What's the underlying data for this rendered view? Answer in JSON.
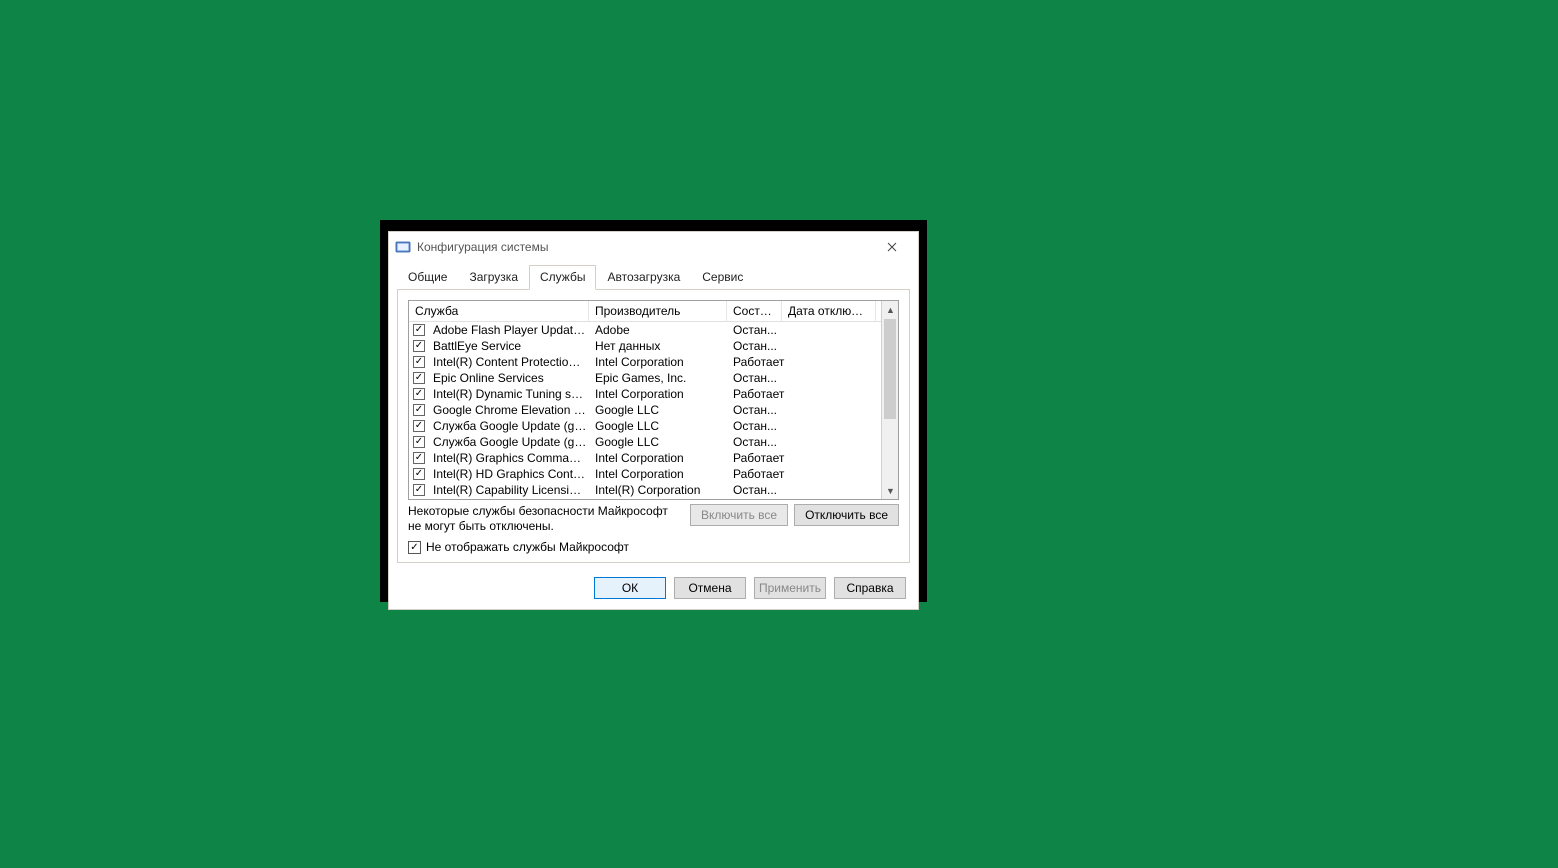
{
  "window": {
    "title": "Конфигурация системы"
  },
  "tabs": {
    "general": "Общие",
    "boot": "Загрузка",
    "services": "Службы",
    "startup": "Автозагрузка",
    "tools": "Сервис",
    "active": "services"
  },
  "columns": {
    "service": "Служба",
    "manufacturer": "Производитель",
    "status": "Состоя...",
    "date": "Дата отключе..."
  },
  "rows": [
    {
      "checked": true,
      "service": "Adobe Flash Player Update Service",
      "manufacturer": "Adobe",
      "status": "Остан...",
      "date": ""
    },
    {
      "checked": true,
      "service": "BattlEye Service",
      "manufacturer": "Нет данных",
      "status": "Остан...",
      "date": ""
    },
    {
      "checked": true,
      "service": "Intel(R) Content Protection HDC...",
      "manufacturer": "Intel Corporation",
      "status": "Работает",
      "date": ""
    },
    {
      "checked": true,
      "service": "Epic Online Services",
      "manufacturer": "Epic Games, Inc.",
      "status": "Остан...",
      "date": ""
    },
    {
      "checked": true,
      "service": "Intel(R) Dynamic Tuning service",
      "manufacturer": "Intel Corporation",
      "status": "Работает",
      "date": ""
    },
    {
      "checked": true,
      "service": "Google Chrome Elevation Servic...",
      "manufacturer": "Google LLC",
      "status": "Остан...",
      "date": ""
    },
    {
      "checked": true,
      "service": "Служба Google Update (gupdate)",
      "manufacturer": "Google LLC",
      "status": "Остан...",
      "date": ""
    },
    {
      "checked": true,
      "service": "Служба Google Update (gupdat...",
      "manufacturer": "Google LLC",
      "status": "Остан...",
      "date": ""
    },
    {
      "checked": true,
      "service": "Intel(R) Graphics Command Cen...",
      "manufacturer": "Intel Corporation",
      "status": "Работает",
      "date": ""
    },
    {
      "checked": true,
      "service": "Intel(R) HD Graphics Control Pa...",
      "manufacturer": "Intel Corporation",
      "status": "Работает",
      "date": ""
    },
    {
      "checked": true,
      "service": "Intel(R) Capability Licensing Ser...",
      "manufacturer": "Intel(R) Corporation",
      "status": "Остан...",
      "date": ""
    }
  ],
  "note": "Некоторые службы безопасности Майкрософт не могут быть отключены.",
  "buttons": {
    "enable_all": "Включить все",
    "disable_all": "Отключить все",
    "hide_ms": "Не отображать службы Майкрософт",
    "ok": "ОК",
    "cancel": "Отмена",
    "apply": "Применить",
    "help": "Справка"
  },
  "hide_ms_checked": true
}
